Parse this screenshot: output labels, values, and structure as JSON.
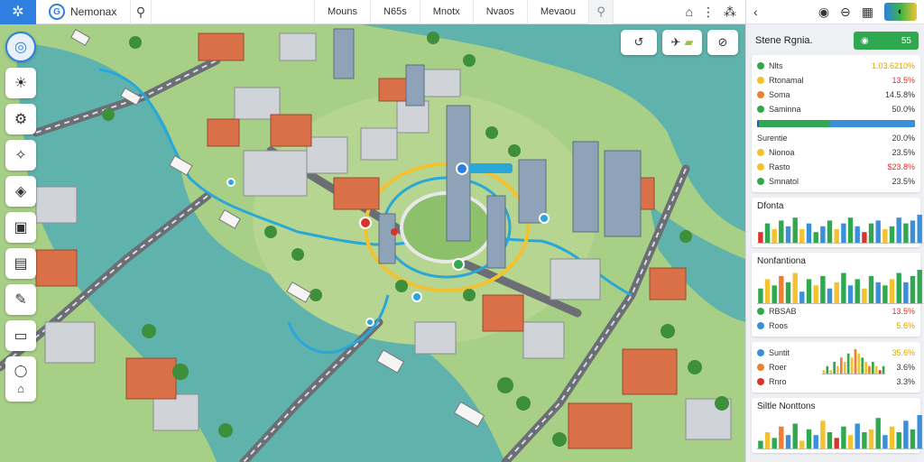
{
  "topbar": {
    "brand": "Nemonax",
    "menu": [
      "Mouns",
      "N65s",
      "Mnotx",
      "Nvaos",
      "Mevaou"
    ],
    "right_icons": [
      "home-icon",
      "more-icon",
      "network-icon"
    ]
  },
  "left_tools": [
    "globe-icon",
    "sun-icon",
    "gear-icon",
    "route-icon",
    "layers-icon",
    "note-icon",
    "calendar-icon",
    "edit-icon",
    "panel-icon",
    "pin-icon"
  ],
  "map_tools": [
    "undo-icon",
    "plane-icon",
    "link-icon"
  ],
  "panel": {
    "region_title": "Stene Rgnia.",
    "region_button": "55",
    "stats_top": [
      {
        "label": "Nlts",
        "value": "1.03.6210%",
        "color": "#2fa84f",
        "vcolor": "#d9a300"
      },
      {
        "label": "Rtonamal",
        "value": "13.5%",
        "color": "#f2c230",
        "vcolor": "#d9342b"
      },
      {
        "label": "Soma",
        "value": "14.5.8%",
        "color": "#f07f2d",
        "vcolor": "#333333"
      },
      {
        "label": "Saminna",
        "value": "50.0%",
        "color": "#2fa84f",
        "vcolor": "#333333"
      }
    ],
    "progress_label": "Surentie",
    "progress_value": "20.0%",
    "stats_mid": [
      {
        "label": "Nionoa",
        "value": "23.5%",
        "color": "#f2c230",
        "vcolor": "#333333"
      },
      {
        "label": "Rasto",
        "value": "$23.8%",
        "color": "#f2c230",
        "vcolor": "#d9342b"
      },
      {
        "label": "Smnatol",
        "value": "23.5%",
        "color": "#2fa84f",
        "vcolor": "#333333"
      }
    ],
    "chart1_title": "Dfonta",
    "chart2_title": "Nonfantiona",
    "stats_low": [
      {
        "label": "RBSAB",
        "value": "13.5%",
        "color": "#2fa84f",
        "vcolor": "#d9342b"
      },
      {
        "label": "Roos",
        "value": "5.6%",
        "color": "#3a8fd8",
        "vcolor": "#d9a300"
      }
    ],
    "stats_low2": [
      {
        "label": "Suntit",
        "value": "35.6%",
        "color": "#3a8fd8",
        "vcolor": "#d9a300"
      },
      {
        "label": "Roer",
        "value": "3.6%",
        "color": "#f07f2d",
        "vcolor": "#333333"
      },
      {
        "label": "Rnro",
        "value": "3.3%",
        "color": "#d9342b",
        "vcolor": "#333333"
      }
    ],
    "chart3_title": "Siltle Nonttons"
  },
  "chart_data": [
    {
      "type": "bar",
      "values": [
        4,
        7,
        5,
        8,
        6,
        9,
        5,
        7,
        4,
        6,
        8,
        5,
        7,
        9,
        6,
        4,
        7,
        8,
        5,
        6,
        9,
        7,
        8,
        10
      ],
      "colors": [
        "#d9342b",
        "#2fa84f",
        "#f2c230",
        "#2fa84f",
        "#3a8fd8",
        "#2fa84f",
        "#f2c230",
        "#3a8fd8",
        "#2fa84f",
        "#3a8fd8",
        "#2fa84f",
        "#f2c230",
        "#3a8fd8",
        "#2fa84f",
        "#3a8fd8",
        "#d9342b",
        "#2fa84f",
        "#3a8fd8",
        "#f2c230",
        "#2fa84f",
        "#3a8fd8",
        "#2fa84f",
        "#3a8fd8",
        "#3a8fd8"
      ]
    },
    {
      "type": "bar",
      "values": [
        5,
        8,
        6,
        9,
        7,
        10,
        4,
        8,
        6,
        9,
        5,
        7,
        10,
        6,
        8,
        5,
        9,
        7,
        6,
        8,
        10,
        7,
        9,
        11
      ],
      "colors": [
        "#2fa84f",
        "#f2c230",
        "#2fa84f",
        "#f07f2d",
        "#2fa84f",
        "#f2c230",
        "#3a8fd8",
        "#2fa84f",
        "#f2c230",
        "#2fa84f",
        "#3a8fd8",
        "#f2c230",
        "#2fa84f",
        "#3a8fd8",
        "#2fa84f",
        "#f2c230",
        "#2fa84f",
        "#3a8fd8",
        "#2fa84f",
        "#f2c230",
        "#2fa84f",
        "#3a8fd8",
        "#2fa84f",
        "#2fa84f"
      ]
    },
    {
      "type": "bar",
      "values": [
        1,
        2,
        1,
        3,
        2,
        4,
        3,
        5,
        4,
        6,
        5,
        4,
        3,
        2,
        3,
        2,
        1,
        2
      ],
      "colors": [
        "#f2c230",
        "#2fa84f",
        "#f2c230",
        "#2fa84f",
        "#f2c230",
        "#f07f2d",
        "#f2c230",
        "#2fa84f",
        "#f2c230",
        "#f07f2d",
        "#f2c230",
        "#2fa84f",
        "#f2c230",
        "#f07f2d",
        "#2fa84f",
        "#f2c230",
        "#d9342b",
        "#2fa84f"
      ]
    },
    {
      "type": "bar",
      "values": [
        3,
        6,
        4,
        8,
        5,
        9,
        3,
        7,
        5,
        10,
        6,
        4,
        8,
        5,
        9,
        6,
        7,
        11,
        5,
        8,
        6,
        10,
        7,
        12
      ],
      "colors": [
        "#2fa84f",
        "#f2c230",
        "#2fa84f",
        "#f07f2d",
        "#3a8fd8",
        "#2fa84f",
        "#f2c230",
        "#2fa84f",
        "#3a8fd8",
        "#f2c230",
        "#2fa84f",
        "#d9342b",
        "#2fa84f",
        "#f2c230",
        "#3a8fd8",
        "#2fa84f",
        "#f2c230",
        "#2fa84f",
        "#3a8fd8",
        "#f2c230",
        "#2fa84f",
        "#3a8fd8",
        "#2fa84f",
        "#3a8fd8"
      ]
    }
  ]
}
